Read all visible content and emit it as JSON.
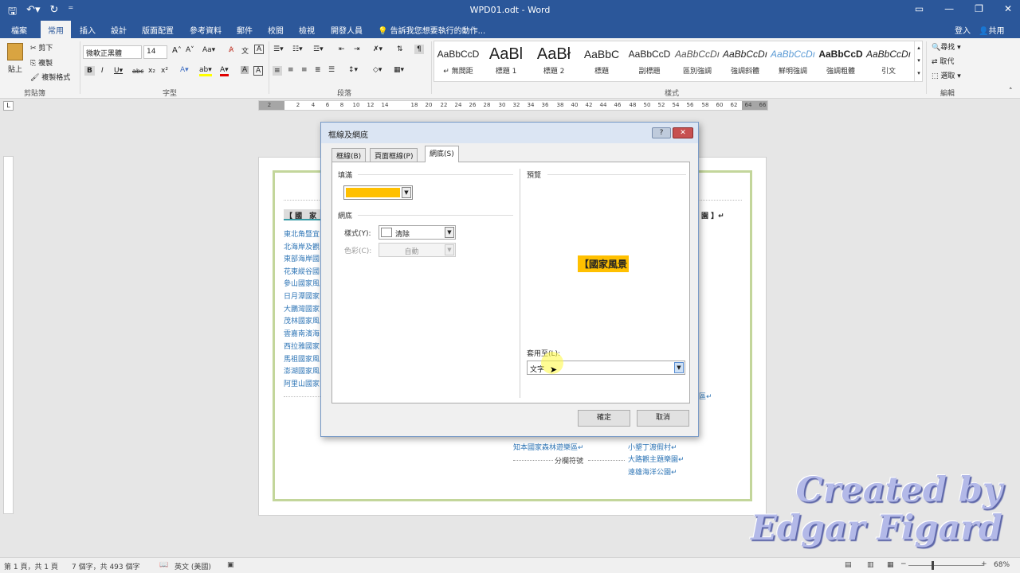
{
  "window": {
    "title": "WPD01.odt - Word"
  },
  "tabs": [
    "檔案",
    "常用",
    "插入",
    "設計",
    "版面配置",
    "參考資料",
    "郵件",
    "校閱",
    "檢視",
    "開發人員"
  ],
  "tell_me": "告訴我您想要執行的動作...",
  "account": {
    "signin": "登入",
    "share": "共用"
  },
  "ribbon": {
    "clipboard": {
      "paste": "貼上",
      "cut": "剪下",
      "copy": "複製",
      "format_painter": "複製格式",
      "label": "剪貼簿"
    },
    "font": {
      "name": "微軟正黑體",
      "size": "14",
      "label": "字型"
    },
    "paragraph": {
      "label": "段落"
    },
    "styles": {
      "label": "樣式",
      "items": [
        {
          "preview": "AaBbCcD",
          "name": "↵ 無間距"
        },
        {
          "preview": "AaBl",
          "name": "標題 1"
        },
        {
          "preview": "AaBł",
          "name": "標題 2"
        },
        {
          "preview": "AaBbC",
          "name": "標題"
        },
        {
          "preview": "AaBbCcD",
          "name": "副標題"
        },
        {
          "preview": "AaBbCcDı",
          "name": "區別強調"
        },
        {
          "preview": "AaBbCcDı",
          "name": "強調斜體"
        },
        {
          "preview": "AaBbCcDı",
          "name": "鮮明強調"
        },
        {
          "preview": "AaBbCcD",
          "name": "強調粗體"
        },
        {
          "preview": "AaBbCcDı",
          "name": "引文"
        }
      ]
    },
    "editing": {
      "find": "尋找",
      "replace": "取代",
      "select": "選取",
      "label": "編輯"
    }
  },
  "ruler": {
    "ticks": [
      "2",
      "2",
      "4",
      "6",
      "8",
      "10",
      "12",
      "14",
      "18",
      "20",
      "22",
      "24",
      "26",
      "28",
      "30",
      "32",
      "34",
      "36",
      "38",
      "40",
      "42",
      "44",
      "46",
      "48",
      "50",
      "52",
      "54",
      "56",
      "58",
      "60",
      "62",
      "64",
      "66"
    ]
  },
  "document": {
    "heading_left": "【 國　家",
    "heading_right": "園 】↵",
    "left_list": [
      "東北角暨宜",
      "北海岸及觀",
      "東部海岸國",
      "花東縱谷國",
      "參山國家風",
      "日月潭國家",
      "大鵬灣國家",
      "茂林國家風",
      "雲嘉南濱海",
      "西拉雅國家",
      "馬祖國家風",
      "澎湖國家風",
      "阿里山國家"
    ],
    "bottom_left": [
      "知本國家森林遊樂區↵"
    ],
    "bottom_right": [
      "小墾丁渡假村↵",
      "大路觀主題樂園↵",
      "遠雄海洋公園↵"
    ],
    "section_break": "分欄符號",
    "edge_fragment": "區↵"
  },
  "dialog": {
    "title": "框線及網底",
    "help": "?",
    "close": "✕",
    "tabs": [
      "框線(B)",
      "頁面框線(P)",
      "網底(S)"
    ],
    "fill_label": "填滿",
    "fill_color": "#ffc000",
    "pattern_label": "網底",
    "style_label": "樣式(Y):",
    "style_value": "清除",
    "color_label": "色彩(C):",
    "color_value": "自動",
    "preview_label": "預覽",
    "preview_text": "【國家風景",
    "apply_label": "套用至(L):",
    "apply_value": "文字",
    "ok": "確定",
    "cancel": "取消"
  },
  "status": {
    "page": "第 1 頁，共 1 頁",
    "words": "7 個字，共 493 個字",
    "lang": "英文 (美國)",
    "zoom": "68%"
  },
  "watermark": [
    "Created by",
    "Edgar Figard"
  ]
}
